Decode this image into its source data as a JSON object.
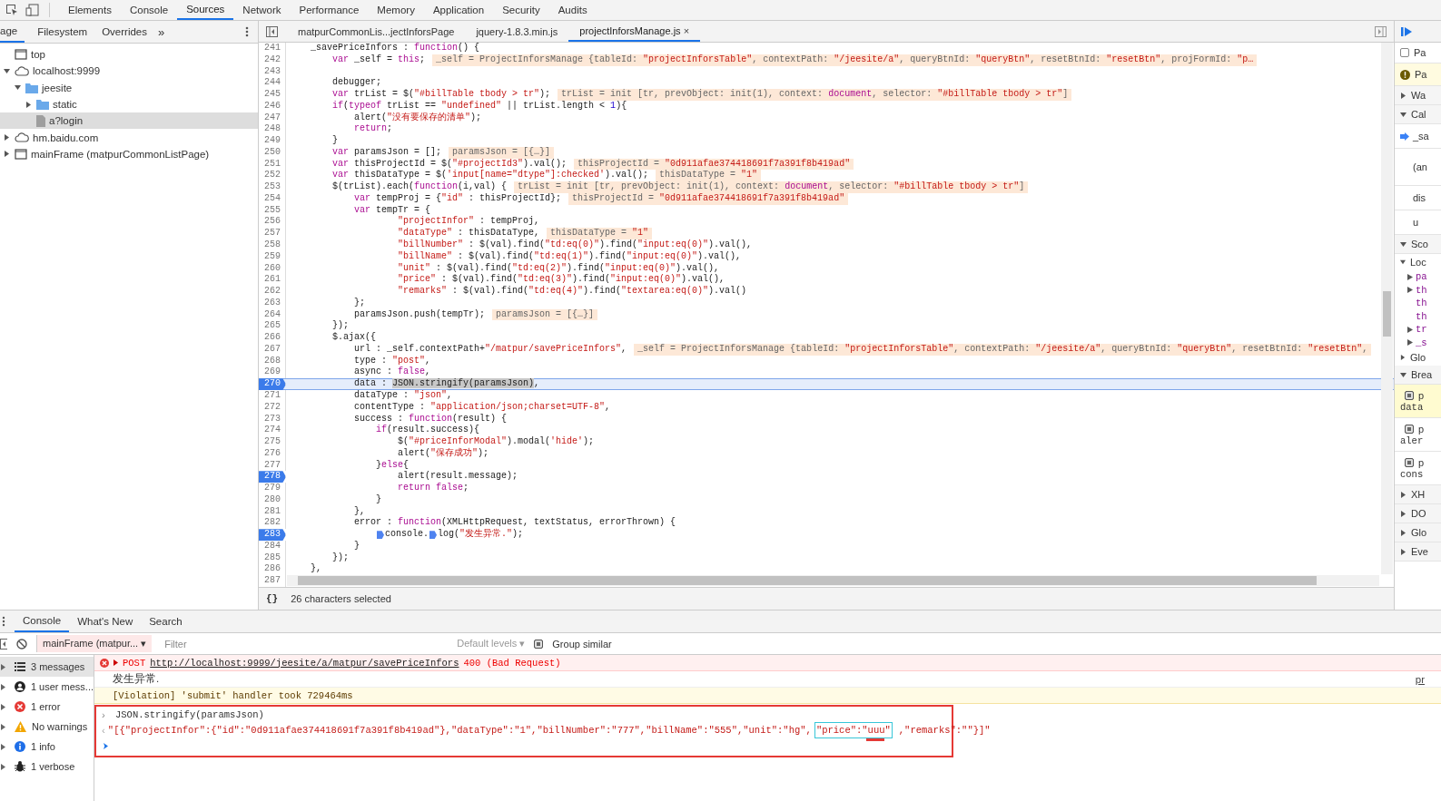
{
  "toolbar": {
    "tabs": [
      {
        "label": "Elements",
        "selected": false
      },
      {
        "label": "Console",
        "selected": false
      },
      {
        "label": "Sources",
        "selected": true
      },
      {
        "label": "Network",
        "selected": false
      },
      {
        "label": "Performance",
        "selected": false
      },
      {
        "label": "Memory",
        "selected": false
      },
      {
        "label": "Application",
        "selected": false
      },
      {
        "label": "Security",
        "selected": false
      },
      {
        "label": "Audits",
        "selected": false
      }
    ]
  },
  "navigator": {
    "tabs": [
      {
        "label": "age",
        "selected": true
      },
      {
        "label": "Filesystem",
        "selected": false
      },
      {
        "label": "Overrides",
        "selected": false
      }
    ],
    "more": "»",
    "tree": [
      {
        "kind": "frame",
        "label": "top",
        "selected": false
      },
      {
        "kind": "cloud",
        "label": "localhost:9999",
        "selected": false,
        "expanded": true,
        "children": [
          {
            "kind": "folder",
            "label": "jeesite",
            "selected": false,
            "expanded": true,
            "children": [
              {
                "kind": "folder",
                "label": "static",
                "selected": false,
                "expanded": false
              },
              {
                "kind": "file",
                "label": "a?login",
                "selected": true
              }
            ]
          }
        ]
      },
      {
        "kind": "cloud",
        "label": "hm.baidu.com",
        "selected": false,
        "expanded": false
      },
      {
        "kind": "frame",
        "label": "mainFrame (matpurCommonListPage)",
        "selected": false,
        "expanded": false
      }
    ]
  },
  "editor": {
    "tabs": [
      {
        "label": "matpurCommonLis...jectInforsPage",
        "selected": false
      },
      {
        "label": "jquery-1.8.3.min.js",
        "selected": false
      },
      {
        "label": "projectInforsManage.js",
        "selected": true,
        "close": "×"
      }
    ],
    "lines": [
      {
        "n": "241",
        "bp": false,
        "cur": false,
        "code": [
          {
            "kind": "p",
            "text": "    _savePriceInfors : "
          },
          {
            "kind": "kw",
            "text": "function"
          },
          {
            "kind": "p",
            "text": "() {"
          }
        ]
      },
      {
        "n": "242",
        "bp": false,
        "cur": false,
        "code": [
          {
            "kind": "kw",
            "text": "        var"
          },
          {
            "kind": "p",
            "text": " _self = "
          },
          {
            "kind": "kw",
            "text": "this"
          },
          {
            "kind": "p",
            "text": ";"
          }
        ],
        "inline": [
          {
            "kind": "p",
            "text": "_self = ProjectInforsManage {tableId: "
          },
          {
            "kind": "str",
            "text": "\"projectInforsTable\""
          },
          {
            "kind": "p",
            "text": ", contextPath: "
          },
          {
            "kind": "str",
            "text": "\"/jeesite/a\""
          },
          {
            "kind": "p",
            "text": ", queryBtnId: "
          },
          {
            "kind": "str",
            "text": "\"queryBtn\""
          },
          {
            "kind": "p",
            "text": ", resetBtnId: "
          },
          {
            "kind": "str",
            "text": "\"resetBtn\""
          },
          {
            "kind": "p",
            "text": ", projFormId: "
          },
          {
            "kind": "str",
            "text": "\"p…"
          }
        ]
      },
      {
        "n": "243",
        "bp": false,
        "cur": false
      },
      {
        "n": "244",
        "bp": false,
        "cur": false,
        "code": [
          {
            "kind": "p",
            "text": "        debugger;"
          }
        ]
      },
      {
        "n": "245",
        "bp": false,
        "cur": false,
        "code": [
          {
            "kind": "kw",
            "text": "        var"
          },
          {
            "kind": "p",
            "text": " trList = $("
          },
          {
            "kind": "str",
            "text": "\"#billTable tbody > tr\""
          },
          {
            "kind": "p",
            "text": ");"
          }
        ],
        "inline": [
          {
            "kind": "p",
            "text": "trList = init [tr, prevObject: init(1), context: "
          },
          {
            "kind": "kw",
            "text": "document"
          },
          {
            "kind": "p",
            "text": ", selector: "
          },
          {
            "kind": "str",
            "text": "\"#billTable tbody > tr\""
          },
          {
            "kind": "p",
            "text": "]"
          }
        ]
      },
      {
        "n": "246",
        "bp": false,
        "cur": false,
        "code": [
          {
            "kind": "kw",
            "text": "        if"
          },
          {
            "kind": "p",
            "text": "("
          },
          {
            "kind": "kw",
            "text": "typeof"
          },
          {
            "kind": "p",
            "text": " trList == "
          },
          {
            "kind": "str",
            "text": "\"undefined\""
          },
          {
            "kind": "p",
            "text": " || trList.length < "
          },
          {
            "kind": "num",
            "text": "1"
          },
          {
            "kind": "p",
            "text": "){"
          }
        ]
      },
      {
        "n": "247",
        "bp": false,
        "cur": false,
        "code": [
          {
            "kind": "p",
            "text": "            alert("
          },
          {
            "kind": "str",
            "text": "\"没有要保存的清单\""
          },
          {
            "kind": "p",
            "text": ");"
          }
        ]
      },
      {
        "n": "248",
        "bp": false,
        "cur": false,
        "code": [
          {
            "kind": "kw",
            "text": "            return"
          },
          {
            "kind": "p",
            "text": ";"
          }
        ]
      },
      {
        "n": "249",
        "bp": false,
        "cur": false,
        "code": [
          {
            "kind": "p",
            "text": "        }"
          }
        ]
      },
      {
        "n": "250",
        "bp": false,
        "cur": false,
        "code": [
          {
            "kind": "kw",
            "text": "        var"
          },
          {
            "kind": "p",
            "text": " paramsJson = [];"
          }
        ],
        "inline": [
          {
            "kind": "p",
            "text": "paramsJson = [{…}]"
          }
        ]
      },
      {
        "n": "251",
        "bp": false,
        "cur": false,
        "code": [
          {
            "kind": "kw",
            "text": "        var"
          },
          {
            "kind": "p",
            "text": " thisProjectId = $("
          },
          {
            "kind": "str",
            "text": "\"#projectId3\""
          },
          {
            "kind": "p",
            "text": ").val();"
          }
        ],
        "inline": [
          {
            "kind": "p",
            "text": "thisProjectId = "
          },
          {
            "kind": "str",
            "text": "\"0d911afae374418691f7a391f8b419ad\""
          }
        ]
      },
      {
        "n": "252",
        "bp": false,
        "cur": false,
        "code": [
          {
            "kind": "kw",
            "text": "        var"
          },
          {
            "kind": "p",
            "text": " thisDataType = $("
          },
          {
            "kind": "str",
            "text": "'input[name=\"dtype\"]:checked'"
          },
          {
            "kind": "p",
            "text": ").val();"
          }
        ],
        "inline": [
          {
            "kind": "p",
            "text": "thisDataType = "
          },
          {
            "kind": "str",
            "text": "\"1\""
          }
        ]
      },
      {
        "n": "253",
        "bp": false,
        "cur": false,
        "code": [
          {
            "kind": "p",
            "text": "        $(trList).each("
          },
          {
            "kind": "kw",
            "text": "function"
          },
          {
            "kind": "p",
            "text": "(i,val) {"
          }
        ],
        "inline": [
          {
            "kind": "p",
            "text": "trList = init [tr, prevObject: init(1), context: "
          },
          {
            "kind": "kw",
            "text": "document"
          },
          {
            "kind": "p",
            "text": ", selector: "
          },
          {
            "kind": "str",
            "text": "\"#billTable tbody > tr\""
          },
          {
            "kind": "p",
            "text": "]"
          }
        ]
      },
      {
        "n": "254",
        "bp": false,
        "cur": false,
        "code": [
          {
            "kind": "kw",
            "text": "            var"
          },
          {
            "kind": "p",
            "text": " tempProj = {"
          },
          {
            "kind": "str",
            "text": "\"id\""
          },
          {
            "kind": "p",
            "text": " : thisProjectId};"
          }
        ],
        "inline": [
          {
            "kind": "p",
            "text": "thisProjectId = "
          },
          {
            "kind": "str",
            "text": "\"0d911afae374418691f7a391f8b419ad\""
          }
        ]
      },
      {
        "n": "255",
        "bp": false,
        "cur": false,
        "code": [
          {
            "kind": "kw",
            "text": "            var"
          },
          {
            "kind": "p",
            "text": " tempTr = {"
          }
        ]
      },
      {
        "n": "256",
        "bp": false,
        "cur": false,
        "code": [
          {
            "kind": "str",
            "text": "                    \"projectInfor\""
          },
          {
            "kind": "p",
            "text": " : tempProj,"
          }
        ]
      },
      {
        "n": "257",
        "bp": false,
        "cur": false,
        "code": [
          {
            "kind": "str",
            "text": "                    \"dataType\""
          },
          {
            "kind": "p",
            "text": " : thisDataType,"
          }
        ],
        "inline": [
          {
            "kind": "p",
            "text": "thisDataType = "
          },
          {
            "kind": "str",
            "text": "\"1\""
          }
        ]
      },
      {
        "n": "258",
        "bp": false,
        "cur": false,
        "code": [
          {
            "kind": "str",
            "text": "                    \"billNumber\""
          },
          {
            "kind": "p",
            "text": " : $(val).find("
          },
          {
            "kind": "str",
            "text": "\"td:eq(0)\""
          },
          {
            "kind": "p",
            "text": ").find("
          },
          {
            "kind": "str",
            "text": "\"input:eq(0)\""
          },
          {
            "kind": "p",
            "text": ").val(),"
          }
        ]
      },
      {
        "n": "259",
        "bp": false,
        "cur": false,
        "code": [
          {
            "kind": "str",
            "text": "                    \"billName\""
          },
          {
            "kind": "p",
            "text": " : $(val).find("
          },
          {
            "kind": "str",
            "text": "\"td:eq(1)\""
          },
          {
            "kind": "p",
            "text": ").find("
          },
          {
            "kind": "str",
            "text": "\"input:eq(0)\""
          },
          {
            "kind": "p",
            "text": ").val(),"
          }
        ]
      },
      {
        "n": "260",
        "bp": false,
        "cur": false,
        "code": [
          {
            "kind": "str",
            "text": "                    \"unit\""
          },
          {
            "kind": "p",
            "text": " : $(val).find("
          },
          {
            "kind": "str",
            "text": "\"td:eq(2)\""
          },
          {
            "kind": "p",
            "text": ").find("
          },
          {
            "kind": "str",
            "text": "\"input:eq(0)\""
          },
          {
            "kind": "p",
            "text": ").val(),"
          }
        ]
      },
      {
        "n": "261",
        "bp": false,
        "cur": false,
        "code": [
          {
            "kind": "str",
            "text": "                    \"price\""
          },
          {
            "kind": "p",
            "text": " : $(val).find("
          },
          {
            "kind": "str",
            "text": "\"td:eq(3)\""
          },
          {
            "kind": "p",
            "text": ").find("
          },
          {
            "kind": "str",
            "text": "\"input:eq(0)\""
          },
          {
            "kind": "p",
            "text": ").val(),"
          }
        ]
      },
      {
        "n": "262",
        "bp": false,
        "cur": false,
        "code": [
          {
            "kind": "str",
            "text": "                    \"remarks\""
          },
          {
            "kind": "p",
            "text": " : $(val).find("
          },
          {
            "kind": "str",
            "text": "\"td:eq(4)\""
          },
          {
            "kind": "p",
            "text": ").find("
          },
          {
            "kind": "str",
            "text": "\"textarea:eq(0)\""
          },
          {
            "kind": "p",
            "text": ").val()"
          }
        ]
      },
      {
        "n": "263",
        "bp": false,
        "cur": false,
        "code": [
          {
            "kind": "p",
            "text": "            };"
          }
        ]
      },
      {
        "n": "264",
        "bp": false,
        "cur": false,
        "code": [
          {
            "kind": "p",
            "text": "            paramsJson.push(tempTr);"
          }
        ],
        "inline": [
          {
            "kind": "p",
            "text": "paramsJson = [{…}]"
          }
        ]
      },
      {
        "n": "265",
        "bp": false,
        "cur": false,
        "code": [
          {
            "kind": "p",
            "text": "        });"
          }
        ]
      },
      {
        "n": "266",
        "bp": false,
        "cur": false,
        "code": [
          {
            "kind": "p",
            "text": "        $.ajax({"
          }
        ]
      },
      {
        "n": "267",
        "bp": false,
        "cur": false,
        "code": [
          {
            "kind": "p",
            "text": "            url : _self.contextPath+"
          },
          {
            "kind": "str",
            "text": "\"/matpur/savePriceInfors\""
          },
          {
            "kind": "p",
            "text": ","
          }
        ],
        "inline": [
          {
            "kind": "p",
            "text": "_self = ProjectInforsManage {tableId: "
          },
          {
            "kind": "str",
            "text": "\"projectInforsTable\""
          },
          {
            "kind": "p",
            "text": ", contextPath: "
          },
          {
            "kind": "str",
            "text": "\"/jeesite/a\""
          },
          {
            "kind": "p",
            "text": ", queryBtnId: "
          },
          {
            "kind": "str",
            "text": "\"queryBtn\""
          },
          {
            "kind": "p",
            "text": ", resetBtnId: "
          },
          {
            "kind": "str",
            "text": "\"resetBtn\""
          },
          {
            "kind": "p",
            "text": ","
          }
        ]
      },
      {
        "n": "268",
        "bp": false,
        "cur": false,
        "code": [
          {
            "kind": "p",
            "text": "            type : "
          },
          {
            "kind": "str",
            "text": "\"post\""
          },
          {
            "kind": "p",
            "text": ","
          }
        ]
      },
      {
        "n": "269",
        "bp": false,
        "cur": false,
        "code": [
          {
            "kind": "p",
            "text": "            async : "
          },
          {
            "kind": "kw",
            "text": "false"
          },
          {
            "kind": "p",
            "text": ","
          }
        ]
      },
      {
        "n": "270",
        "bp": true,
        "cur": true,
        "code": [
          {
            "kind": "p",
            "text": "            data : "
          },
          {
            "kind": "sel",
            "text": "JSON.stringify(paramsJson)"
          },
          {
            "kind": "p",
            "text": ","
          }
        ]
      },
      {
        "n": "271",
        "bp": false,
        "cur": false,
        "code": [
          {
            "kind": "p",
            "text": "            dataType : "
          },
          {
            "kind": "str",
            "text": "\"json\""
          },
          {
            "kind": "p",
            "text": ","
          }
        ]
      },
      {
        "n": "272",
        "bp": false,
        "cur": false,
        "code": [
          {
            "kind": "p",
            "text": "            contentType : "
          },
          {
            "kind": "str",
            "text": "\"application/json;charset=UTF-8\""
          },
          {
            "kind": "p",
            "text": ","
          }
        ]
      },
      {
        "n": "273",
        "bp": false,
        "cur": false,
        "code": [
          {
            "kind": "p",
            "text": "            success : "
          },
          {
            "kind": "kw",
            "text": "function"
          },
          {
            "kind": "p",
            "text": "(result) {"
          }
        ]
      },
      {
        "n": "274",
        "bp": false,
        "cur": false,
        "code": [
          {
            "kind": "kw",
            "text": "                if"
          },
          {
            "kind": "p",
            "text": "(result.success){"
          }
        ]
      },
      {
        "n": "275",
        "bp": false,
        "cur": false,
        "code": [
          {
            "kind": "p",
            "text": "                    $("
          },
          {
            "kind": "str",
            "text": "\"#priceInforModal\""
          },
          {
            "kind": "p",
            "text": ").modal("
          },
          {
            "kind": "str",
            "text": "'hide'"
          },
          {
            "kind": "p",
            "text": ");"
          }
        ]
      },
      {
        "n": "276",
        "bp": false,
        "cur": false,
        "code": [
          {
            "kind": "p",
            "text": "                    alert("
          },
          {
            "kind": "str",
            "text": "\"保存成功\""
          },
          {
            "kind": "p",
            "text": ");"
          }
        ]
      },
      {
        "n": "277",
        "bp": false,
        "cur": false,
        "code": [
          {
            "kind": "p",
            "text": "                }"
          },
          {
            "kind": "kw",
            "text": "else"
          },
          {
            "kind": "p",
            "text": "{"
          }
        ]
      },
      {
        "n": "278",
        "bp": true,
        "cur": false,
        "code": [
          {
            "kind": "p",
            "text": "                    alert(result.message);"
          }
        ]
      },
      {
        "n": "279",
        "bp": false,
        "cur": false,
        "code": [
          {
            "kind": "kw",
            "text": "                    return false"
          },
          {
            "kind": "p",
            "text": ";"
          }
        ]
      },
      {
        "n": "280",
        "bp": false,
        "cur": false,
        "code": [
          {
            "kind": "p",
            "text": "                }"
          }
        ]
      },
      {
        "n": "281",
        "bp": false,
        "cur": false,
        "code": [
          {
            "kind": "p",
            "text": "            },"
          }
        ]
      },
      {
        "n": "282",
        "bp": false,
        "cur": false,
        "code": [
          {
            "kind": "p",
            "text": "            error : "
          },
          {
            "kind": "kw",
            "text": "function"
          },
          {
            "kind": "p",
            "text": "(XMLHttpRequest, textStatus, errorThrown) {"
          }
        ]
      },
      {
        "n": "283",
        "bp": true,
        "cur": false,
        "code": [
          {
            "kind": "mark"
          },
          {
            "kind": "p",
            "text": "console."
          },
          {
            "kind": "mark"
          },
          {
            "kind": "p",
            "text": "log("
          },
          {
            "kind": "str",
            "text": "\"发生异常.\""
          },
          {
            "kind": "p",
            "text": ");"
          }
        ]
      },
      {
        "n": "284",
        "bp": false,
        "cur": false,
        "code": [
          {
            "kind": "p",
            "text": "            }"
          }
        ]
      },
      {
        "n": "285",
        "bp": false,
        "cur": false,
        "code": [
          {
            "kind": "p",
            "text": "        });"
          }
        ]
      },
      {
        "n": "286",
        "bp": false,
        "cur": false,
        "code": [
          {
            "kind": "p",
            "text": "    },"
          }
        ]
      },
      {
        "n": "287",
        "bp": false,
        "cur": false
      }
    ],
    "status": {
      "icon": "{}",
      "text": "26 characters selected"
    }
  },
  "debugger": {
    "items": [
      {
        "kind": "toolbar"
      },
      {
        "kind": "checkbox",
        "text": "Pa",
        "checked": false
      },
      {
        "kind": "banner",
        "text": "Pa"
      },
      {
        "kind": "section",
        "text": "Wa",
        "expanded": false
      },
      {
        "kind": "section",
        "text": "Cal",
        "expanded": true
      },
      {
        "kind": "frame",
        "text": "_sa",
        "current": true
      },
      {
        "kind": "frame",
        "text": "(an",
        "current": false
      },
      {
        "kind": "frame",
        "text": "dis",
        "current": false
      },
      {
        "kind": "frame",
        "text": "u",
        "current": false
      },
      {
        "kind": "section",
        "text": "Sco",
        "expanded": true
      },
      {
        "kind": "scope",
        "text": "Loc",
        "expanded": true
      },
      {
        "kind": "var",
        "text": "pa",
        "expandable": true
      },
      {
        "kind": "var",
        "text": "th",
        "expandable": true
      },
      {
        "kind": "var",
        "text": "th",
        "expandable": false
      },
      {
        "kind": "var",
        "text": "th",
        "expandable": false
      },
      {
        "kind": "var",
        "text": "tr",
        "expandable": true
      },
      {
        "kind": "var",
        "text": "_s",
        "expandable": true
      },
      {
        "kind": "scope",
        "text": "Glo",
        "expanded": false
      },
      {
        "kind": "section",
        "text": "Brea",
        "expanded": true
      },
      {
        "kind": "breakpoint",
        "text": "p",
        "code": "data",
        "checked": true,
        "active": true
      },
      {
        "kind": "breakpoint",
        "text": "p",
        "code": "aler",
        "checked": true,
        "active": false
      },
      {
        "kind": "breakpoint",
        "text": "p",
        "code": "cons",
        "checked": true,
        "active": false
      },
      {
        "kind": "section",
        "text": "XH",
        "expanded": false
      },
      {
        "kind": "section",
        "text": "DO",
        "expanded": false
      },
      {
        "kind": "section",
        "text": "Glo",
        "expanded": false
      },
      {
        "kind": "section",
        "text": "Eve",
        "expanded": false
      }
    ]
  },
  "drawer": {
    "tabs": [
      {
        "label": "Console",
        "selected": true
      },
      {
        "label": "What's New",
        "selected": false
      },
      {
        "label": "Search",
        "selected": false
      }
    ],
    "context": {
      "label": "mainFrame (matpur...",
      "caret": "▾"
    },
    "filter": {
      "placeholder": "Filter"
    },
    "levels": {
      "label": "Default levels",
      "caret": "▾"
    },
    "group_similar": {
      "label": "Group similar",
      "checked": true
    },
    "sidebar": [
      {
        "kind": "list",
        "label": "3 messages",
        "selected": true
      },
      {
        "kind": "user",
        "label": "1 user mess...",
        "selected": false
      },
      {
        "kind": "error",
        "label": "1 error",
        "selected": false
      },
      {
        "kind": "warning",
        "label": "No warnings",
        "selected": false
      },
      {
        "kind": "info",
        "label": "1 info",
        "selected": false
      },
      {
        "kind": "verbose",
        "label": "1 verbose",
        "selected": false
      }
    ],
    "messages": [
      {
        "kind": "error",
        "method": "POST",
        "url": "http://localhost:9999/jeesite/a/matpur/savePriceInfors",
        "status": "400 (Bad Request)"
      },
      {
        "kind": "log",
        "text": "发生异常.",
        "source": "pr"
      },
      {
        "kind": "violation",
        "text": "[Violation] 'submit' handler took 729464ms"
      }
    ],
    "repl": {
      "input_prompt": "›",
      "input": "JSON.stringify(paramsJson)",
      "result_prompt": "‹",
      "result_before": "\"[{\"projectInfor\":{\"id\":\"0d911afae374418691f7a391f8b419ad\"},\"dataType\":\"1\",\"billNumber\":\"777\",\"billName\":\"555\",\"unit\":\"hg\",",
      "result_boxed": "\"price\":\"uuu\"",
      "result_after": ",\"remarks\":\"\"}]\""
    }
  }
}
